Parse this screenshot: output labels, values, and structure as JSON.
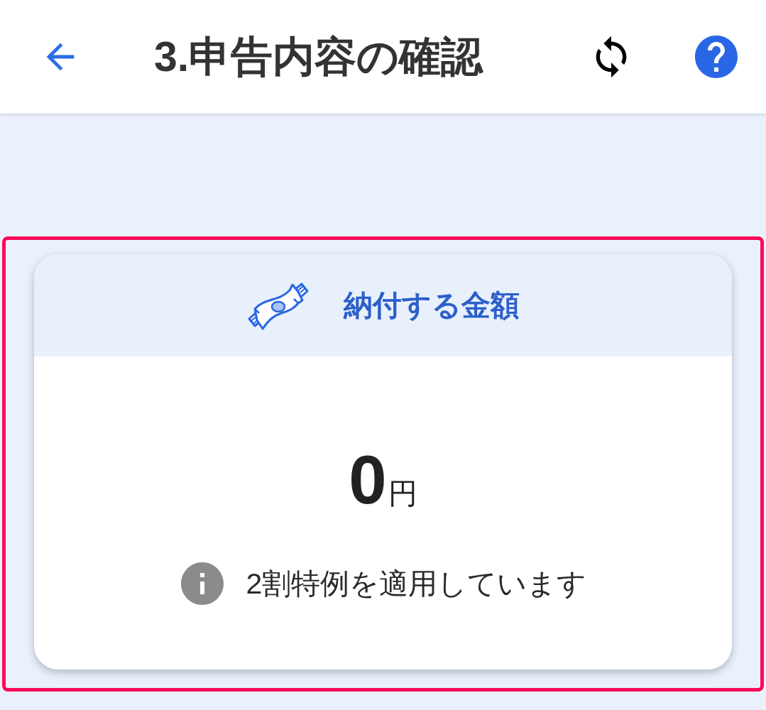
{
  "header": {
    "title": "3.申告内容の確認"
  },
  "payment_card": {
    "title": "納付する金額",
    "amount": "0",
    "unit": "円",
    "note": "2割特例を適用しています"
  }
}
